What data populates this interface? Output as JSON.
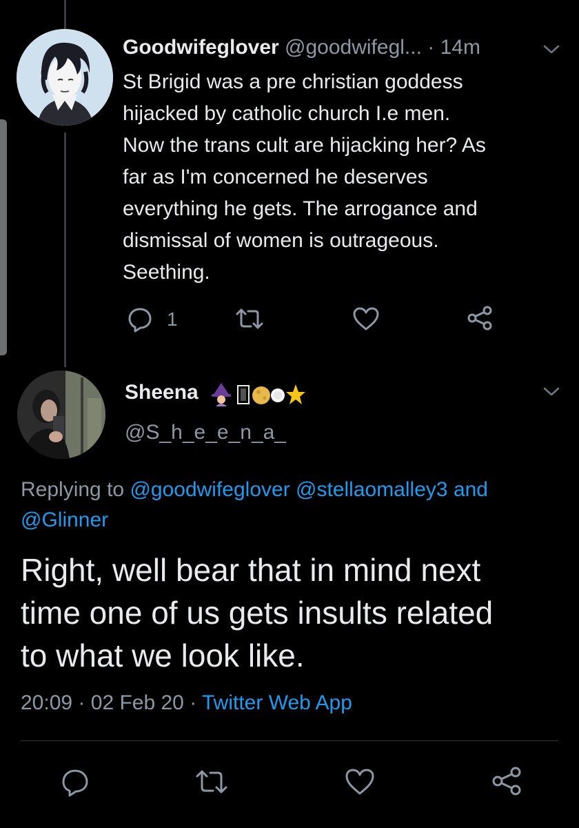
{
  "tweet1": {
    "name": "Goodwifeglover",
    "handle": "@goodwifegl...",
    "separator": "·",
    "time": "14m",
    "body_lines": [
      "St Brigid was a pre christian goddess",
      "hijacked by catholic church I.e men.",
      "Now the trans cult are hijacking her? As",
      "far as I'm concerned he deserves",
      "everything he gets. The arrogance and",
      "dismissal of women is outrageous.",
      "Seething."
    ],
    "reply_count": "1",
    "icons": [
      "reply-icon",
      "retweet-icon",
      "like-icon",
      "share-icon",
      "chevron-down-icon"
    ]
  },
  "tweet2": {
    "name": "Sheena",
    "name_emoji": "🧙‍♀️🌕☀️⭐",
    "handle": "@S_h_e_e_n_a_",
    "replying_prefix": "Replying to",
    "replying_mentions": [
      "@goodwifeglover",
      "@stellaomalley3"
    ],
    "replying_and": "and",
    "replying_last": "@Glinner",
    "body_lines": [
      "Right, well bear that in mind next",
      "time one of us gets insults related",
      "to what we look like."
    ],
    "time": "20:09",
    "separator": "·",
    "date": "02 Feb 20",
    "source": "Twitter Web App",
    "icons": [
      "reply-icon",
      "retweet-icon",
      "like-icon",
      "share-icon",
      "chevron-down-icon"
    ]
  },
  "colors": {
    "background": "#000000",
    "text": "#e8eaec",
    "secondary": "#8b98a5",
    "link": "#1d9bf0",
    "thread_line": "#3a3d40"
  }
}
